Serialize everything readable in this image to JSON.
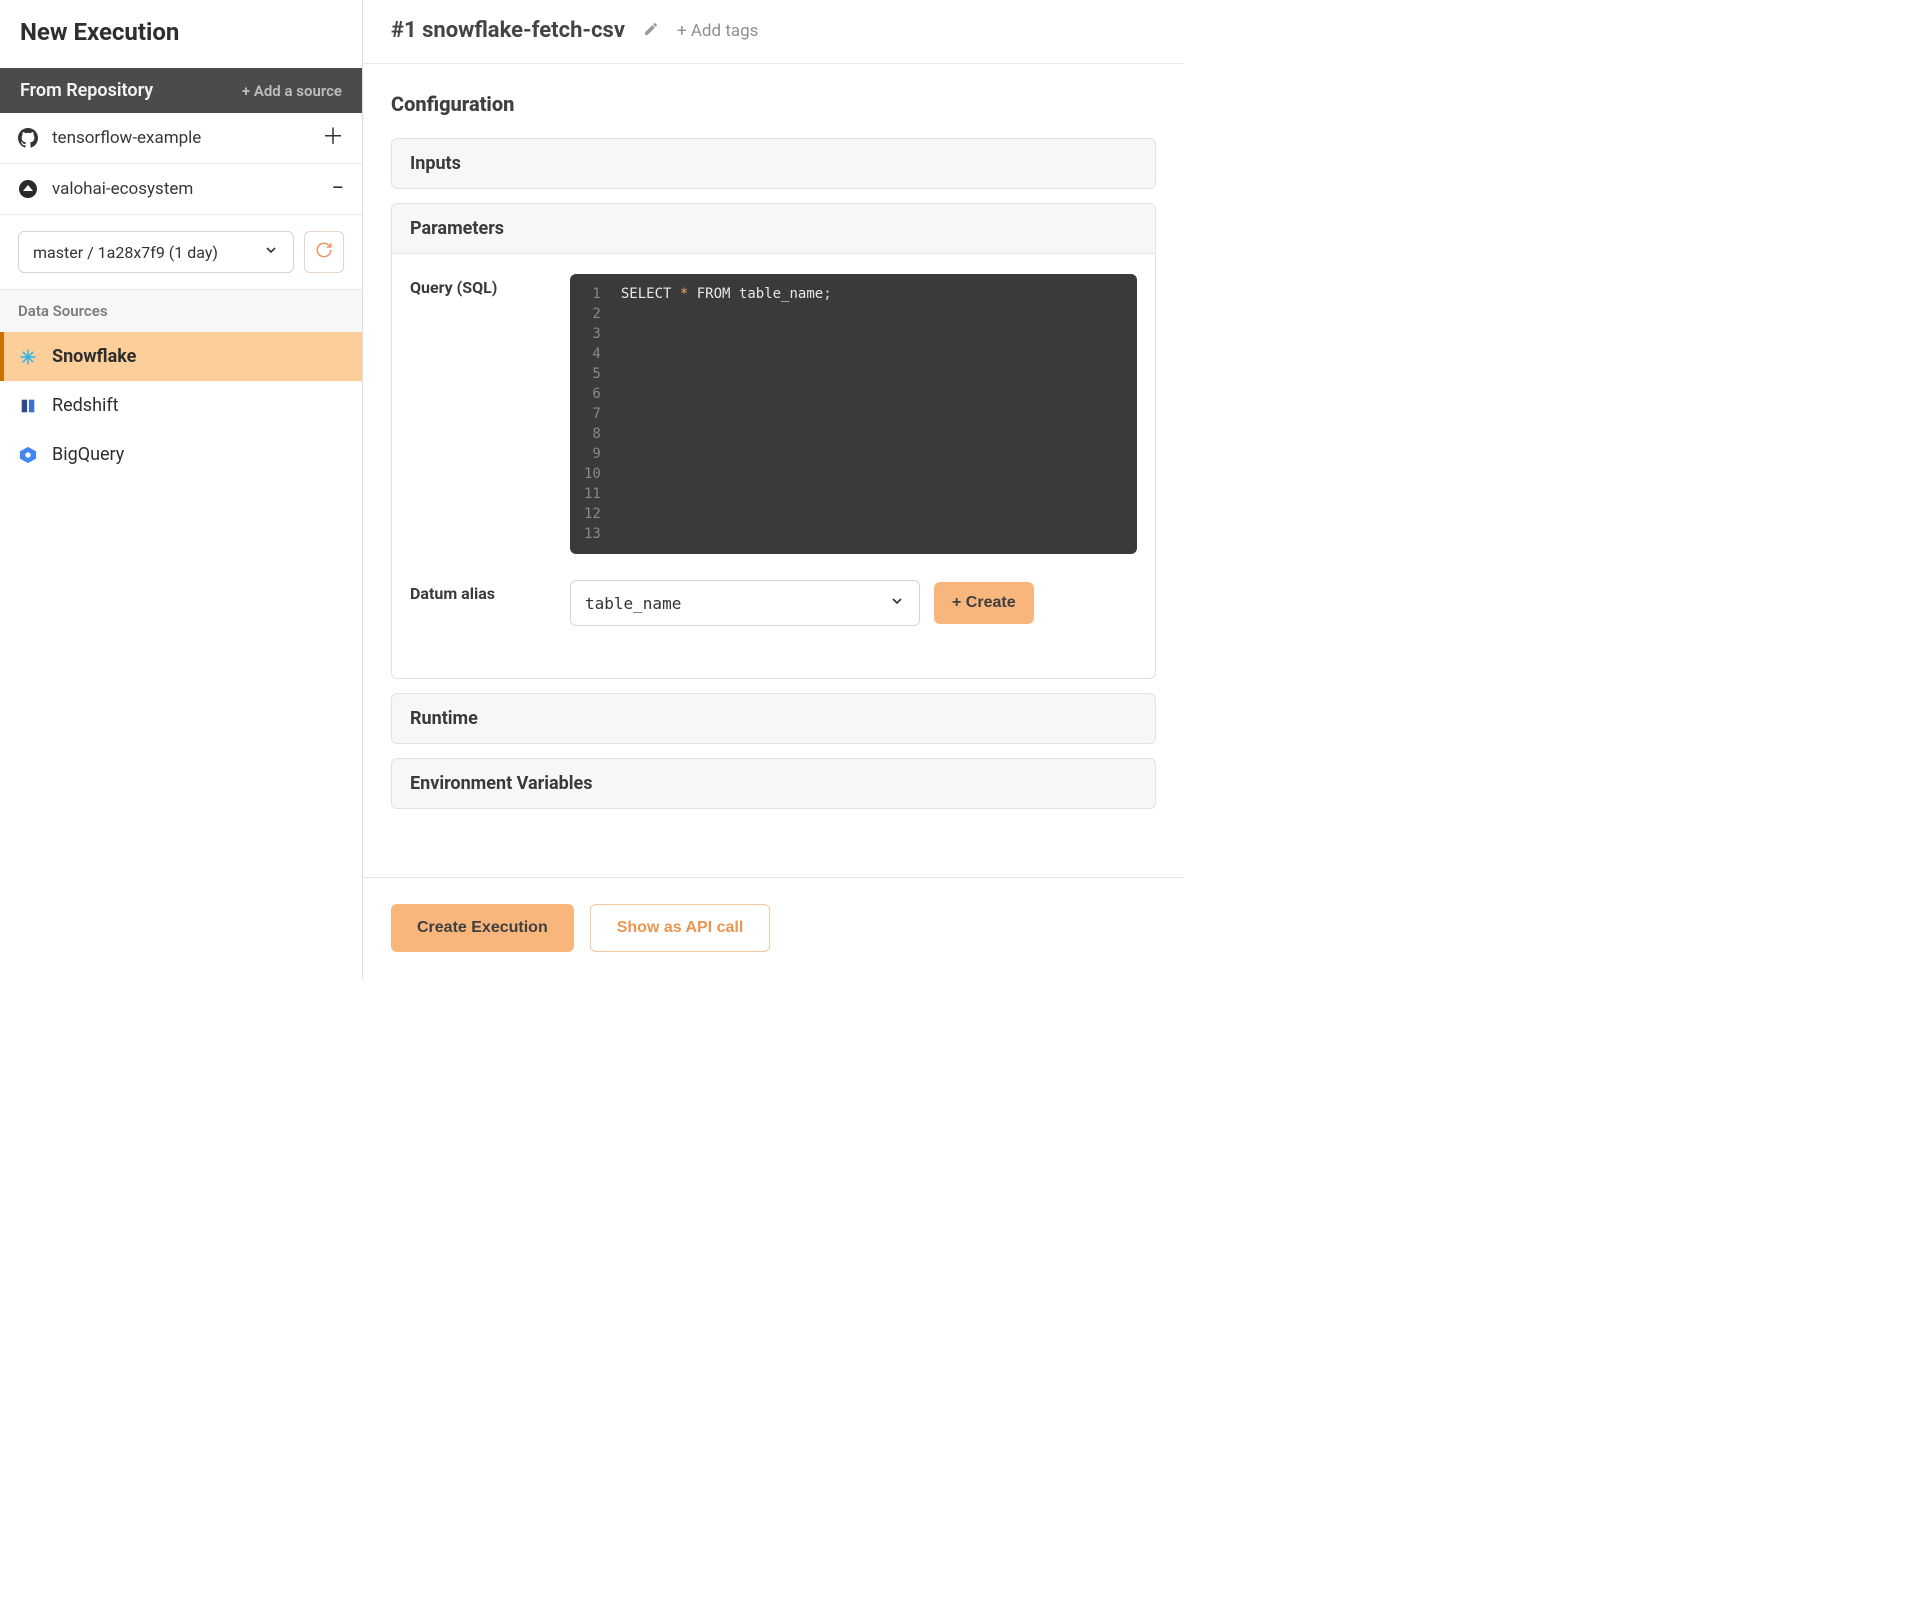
{
  "sidebar": {
    "title": "New Execution",
    "from_repo_label": "From Repository",
    "add_source_label": "+ Add a source",
    "repos": [
      {
        "name": "tensorflow-example",
        "action_glyph": "＋",
        "icon": "github"
      },
      {
        "name": "valohai-ecosystem",
        "action_glyph": "−",
        "icon": "valohai"
      }
    ],
    "branch_selector": "master / 1a28x7f9 (1 day)",
    "data_sources_label": "Data Sources",
    "data_sources": [
      {
        "name": "Snowflake",
        "active": true
      },
      {
        "name": "Redshift",
        "active": false
      },
      {
        "name": "BigQuery",
        "active": false
      }
    ]
  },
  "header": {
    "execution_title": "#1 snowflake-fetch-csv",
    "add_tags_label": "+ Add tags"
  },
  "config": {
    "heading": "Configuration",
    "inputs_label": "Inputs",
    "parameters_label": "Parameters",
    "query_label": "Query (SQL)",
    "query_code": "SELECT * FROM table_name;",
    "code_lines": "13",
    "datum_alias_label": "Datum alias",
    "datum_alias_value": "table_name",
    "create_button": "+ Create",
    "runtime_label": "Runtime",
    "envvars_label": "Environment Variables"
  },
  "footer": {
    "create_execution": "Create Execution",
    "show_api": "Show as API call"
  }
}
